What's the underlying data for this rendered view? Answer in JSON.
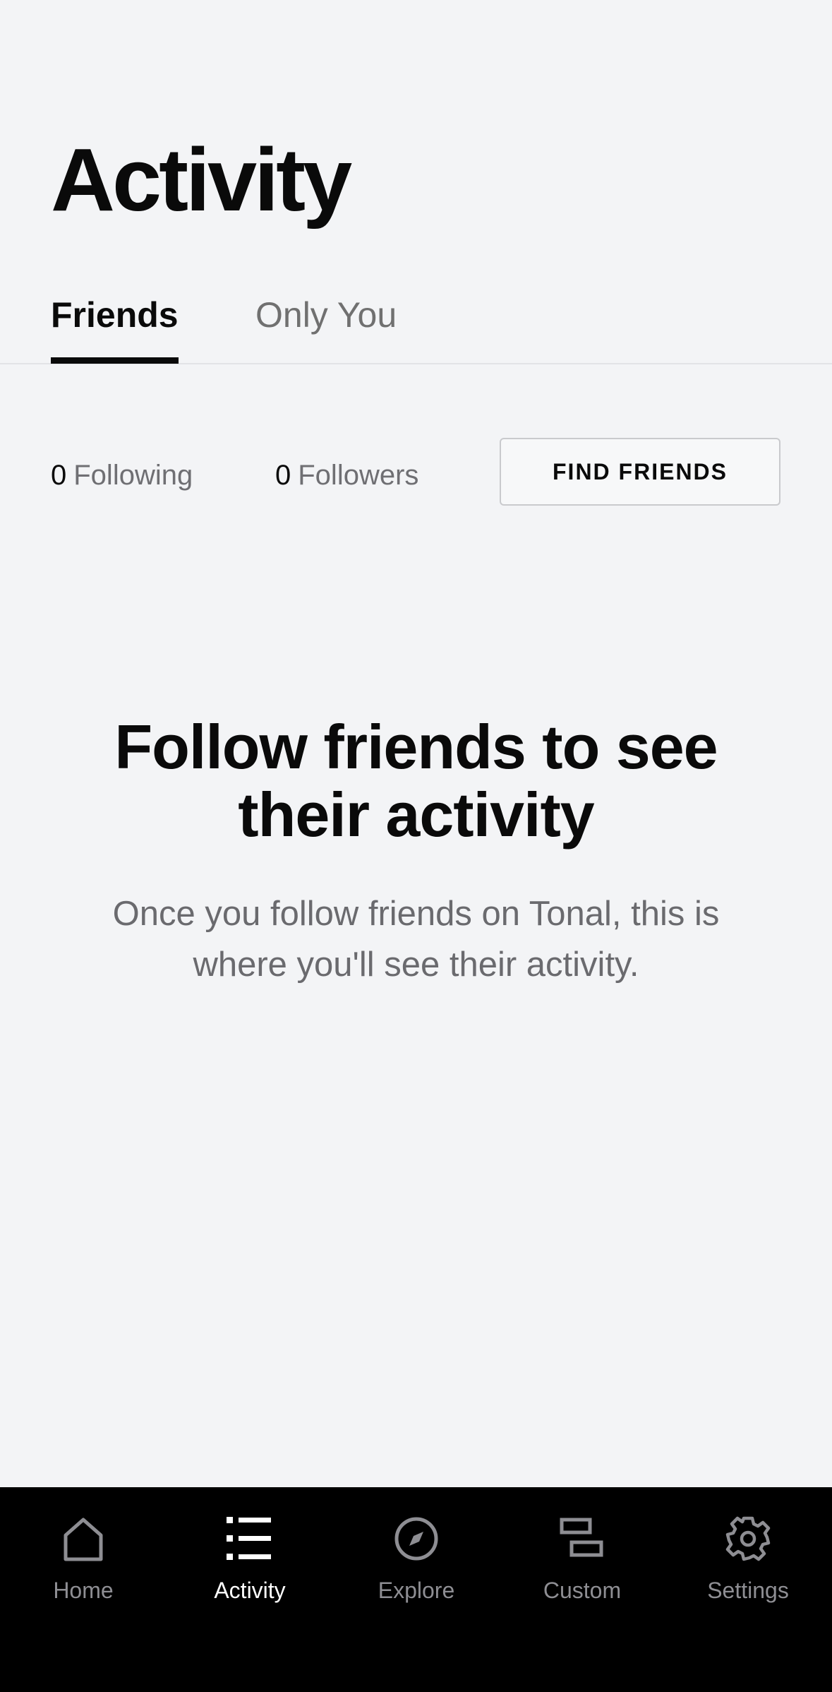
{
  "header": {
    "title": "Activity"
  },
  "tabs": [
    {
      "label": "Friends",
      "selected": true
    },
    {
      "label": "Only You",
      "selected": false
    }
  ],
  "stats": {
    "following_count": "0",
    "following_label": "Following",
    "followers_count": "0",
    "followers_label": "Followers",
    "find_friends_label": "FIND FRIENDS"
  },
  "empty_state": {
    "title": "Follow friends to see their activity",
    "body": "Once you follow friends on Tonal, this is where you'll see their activity."
  },
  "bottom_nav": {
    "items": [
      {
        "label": "Home",
        "icon": "home-icon",
        "active": false
      },
      {
        "label": "Activity",
        "icon": "list-icon",
        "active": true
      },
      {
        "label": "Explore",
        "icon": "compass-icon",
        "active": false
      },
      {
        "label": "Custom",
        "icon": "custom-blocks-icon",
        "active": false
      },
      {
        "label": "Settings",
        "icon": "gear-icon",
        "active": false
      }
    ]
  },
  "colors": {
    "background": "#f3f4f6",
    "text_primary": "#0a0a0a",
    "text_secondary": "#6f6f73",
    "nav_background": "#000000",
    "nav_inactive": "#8e8e93",
    "nav_active": "#ffffff"
  }
}
